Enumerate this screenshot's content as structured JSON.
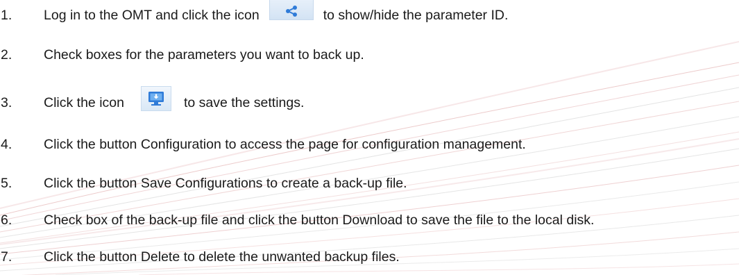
{
  "steps": [
    {
      "num": "1.",
      "before": "Log in to the OMT and click the icon",
      "after": "to show/hide the parameter ID.",
      "icon": "share-icon"
    },
    {
      "num": "2.",
      "text": "Check boxes for the parameters you want to back up."
    },
    {
      "num": "3.",
      "before": "Click the icon",
      "after": "to save the settings.",
      "icon": "save-download-icon"
    },
    {
      "num": "4.",
      "text": "Click the button Configuration to access the page for configuration management."
    },
    {
      "num": "5.",
      "text": "Click the button Save Configurations to create a back-up file."
    },
    {
      "num": "6.",
      "text": "Check box of the back-up file and click the button Download to save the file to the local disk."
    },
    {
      "num": "7.",
      "text": "Click the button Delete to delete the unwanted backup files."
    }
  ],
  "colors": {
    "text": "#1a1a1a",
    "swoosh_red": "#d9888a",
    "swoosh_gray": "#c9c9c9",
    "icon_blue": "#2f7bd8",
    "icon_bg": "#dbe8f5"
  }
}
